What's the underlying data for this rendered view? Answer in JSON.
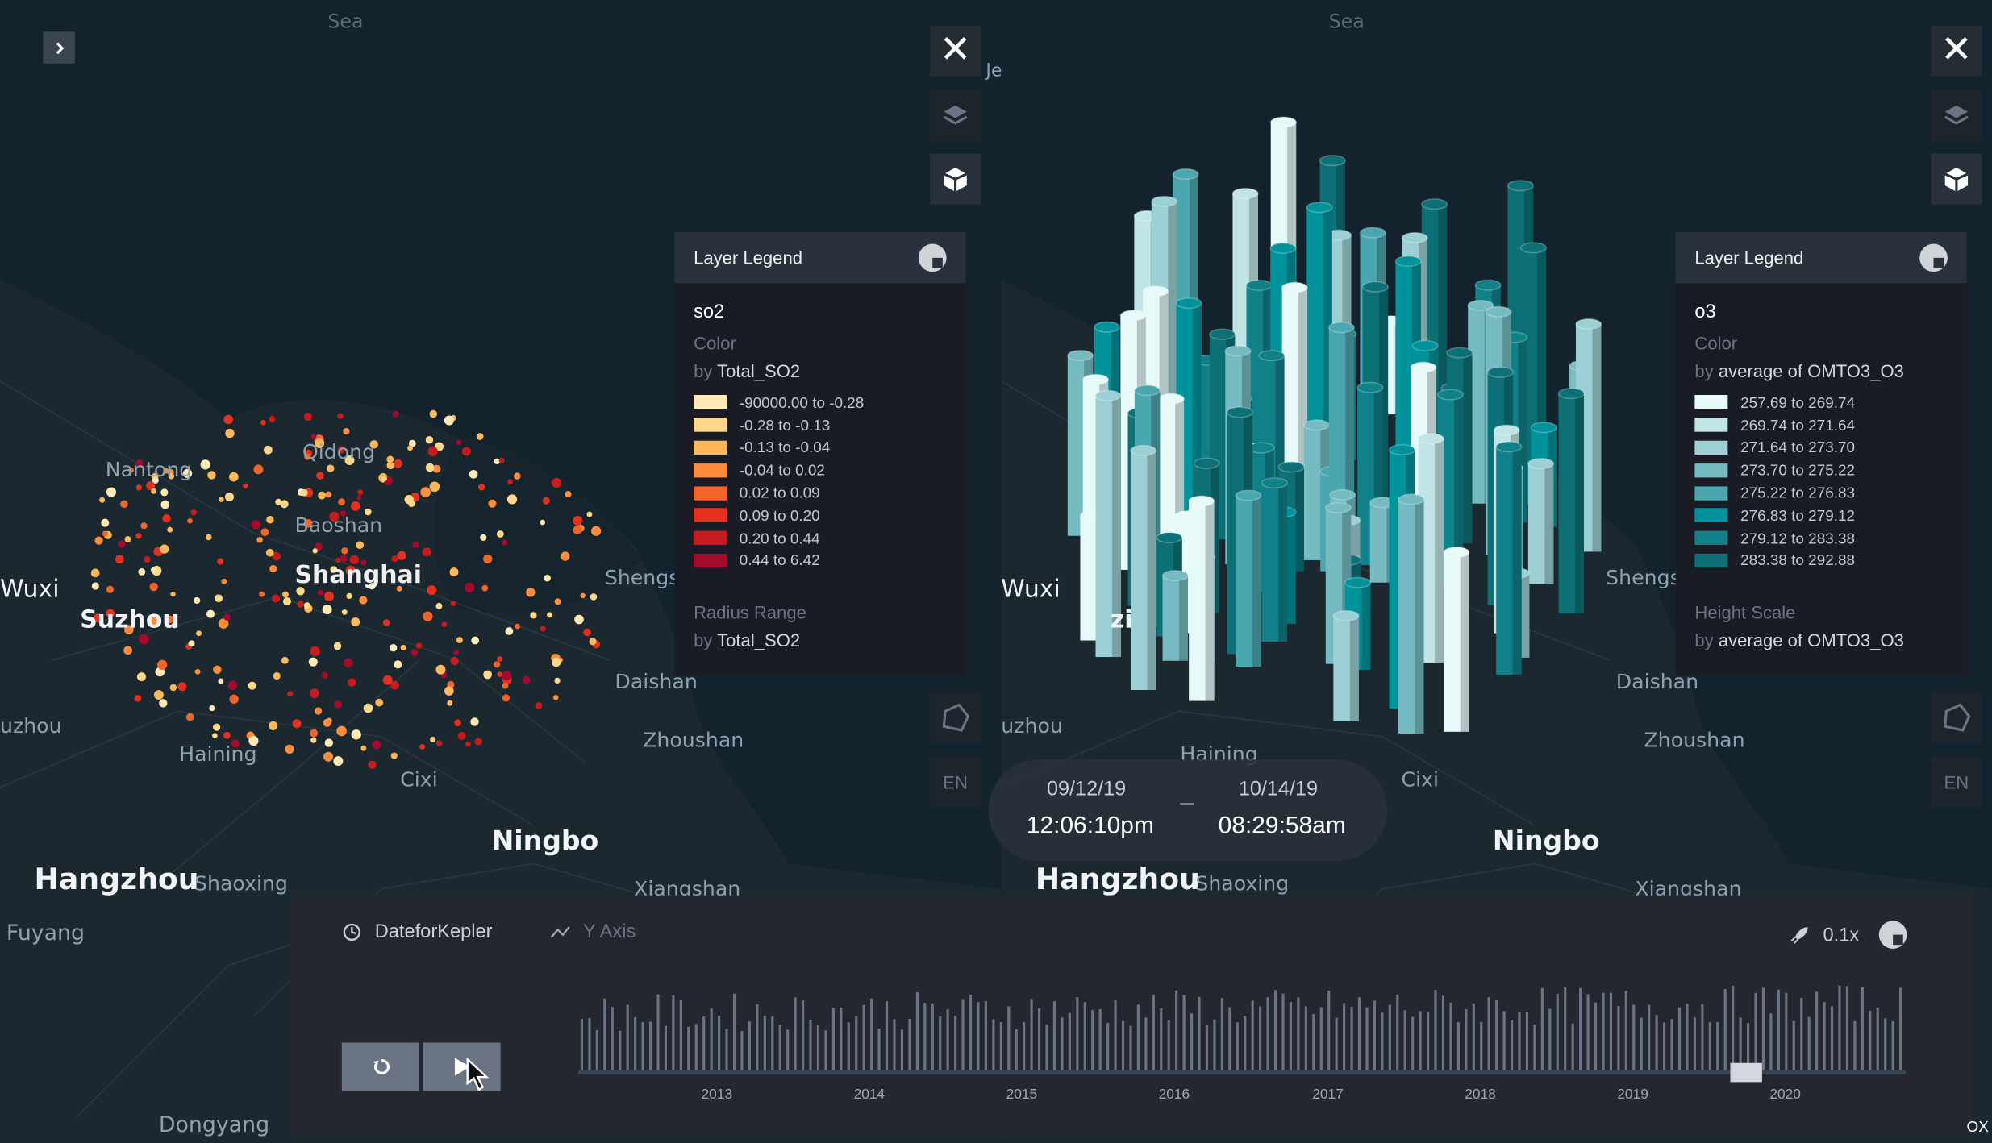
{
  "left_panel": {
    "legend": {
      "title": "Layer Legend",
      "layer_name": "so2",
      "color_label": "Color",
      "color_by_prefix": "by",
      "color_by_field": "Total_SO2",
      "items": [
        {
          "label": "-90000.00 to -0.28",
          "color": "#ffeab7"
        },
        {
          "label": "-0.28 to -0.13",
          "color": "#fed889"
        },
        {
          "label": "-0.13 to -0.04",
          "color": "#fdb85a"
        },
        {
          "label": "-0.04 to 0.02",
          "color": "#fd8d3c"
        },
        {
          "label": "0.02 to 0.09",
          "color": "#f2642a"
        },
        {
          "label": "0.09 to 0.20",
          "color": "#e3301f"
        },
        {
          "label": "0.20 to 0.44",
          "color": "#c81b20"
        },
        {
          "label": "0.44 to 6.42",
          "color": "#a7092c"
        }
      ],
      "radius_label": "Radius Range",
      "radius_by_prefix": "by",
      "radius_by_field": "Total_SO2"
    },
    "lang_label": "EN",
    "places": {
      "sea": "Sea",
      "nantong": "Nantong",
      "qidong": "Qidong",
      "baoshan": "Baoshan",
      "shanghai": "Shanghai",
      "wuxi": "Wuxi",
      "suzhou": "Suzhou",
      "shengs": "Shengs",
      "daishan": "Daishan",
      "zhoushan": "Zhoushan",
      "uzhou": "uzhou",
      "haining": "Haining",
      "cixi": "Cixi",
      "ningbo": "Ningbo",
      "hangzhou": "Hangzhou",
      "shaoxing": "Shaoxing",
      "xiangshan": "Xiangshan",
      "fuyang": "Fuyang",
      "dongyang": "Dongyang",
      "je": "Je"
    }
  },
  "right_panel": {
    "legend": {
      "title": "Layer Legend",
      "layer_name": "o3",
      "color_label": "Color",
      "color_by_prefix": "by",
      "color_by_field": "average of OMTO3_O3",
      "items": [
        {
          "label": "257.69 to 269.74",
          "color": "#e6fafa"
        },
        {
          "label": "269.74 to 271.64",
          "color": "#c1e5e6"
        },
        {
          "label": "271.64 to 273.70",
          "color": "#9dd0d4"
        },
        {
          "label": "273.70 to 275.22",
          "color": "#75bbc1"
        },
        {
          "label": "275.22 to 276.83",
          "color": "#4ba7af"
        },
        {
          "label": "276.83 to 279.12",
          "color": "#00939c"
        },
        {
          "label": "279.12 to 283.38",
          "color": "#108188"
        },
        {
          "label": "283.38 to 292.88",
          "color": "#0e7077"
        }
      ],
      "height_label": "Height Scale",
      "height_by_prefix": "by",
      "height_by_field": "average of OMTO3_O3"
    },
    "lang_label": "EN",
    "places": {
      "sea": "Sea",
      "wuxi": "Wuxi",
      "shengs": "Shengs",
      "daishan": "Daishan",
      "zhoushan": "Zhoushan",
      "uzhou": "uzhou",
      "haining": "Haining",
      "cixi": "Cixi",
      "ningbo": "Ningbo",
      "hangzhou": "Hangzhou",
      "shaoxing": "Shaoxing",
      "xiangshan": "Xiangshan",
      "zi": "zi"
    }
  },
  "time_window": {
    "start_date": "09/12/19",
    "start_time": "12:06:10pm",
    "separator": "–",
    "end_date": "10/14/19",
    "end_time": "08:29:58am"
  },
  "timebar": {
    "field_label": "DateforKepler",
    "y_axis_label": "Y Axis",
    "speed_label": "0.1x",
    "years": [
      "2013",
      "2014",
      "2015",
      "2016",
      "2017",
      "2018",
      "2019",
      "2020"
    ],
    "corner_label": "OX"
  }
}
